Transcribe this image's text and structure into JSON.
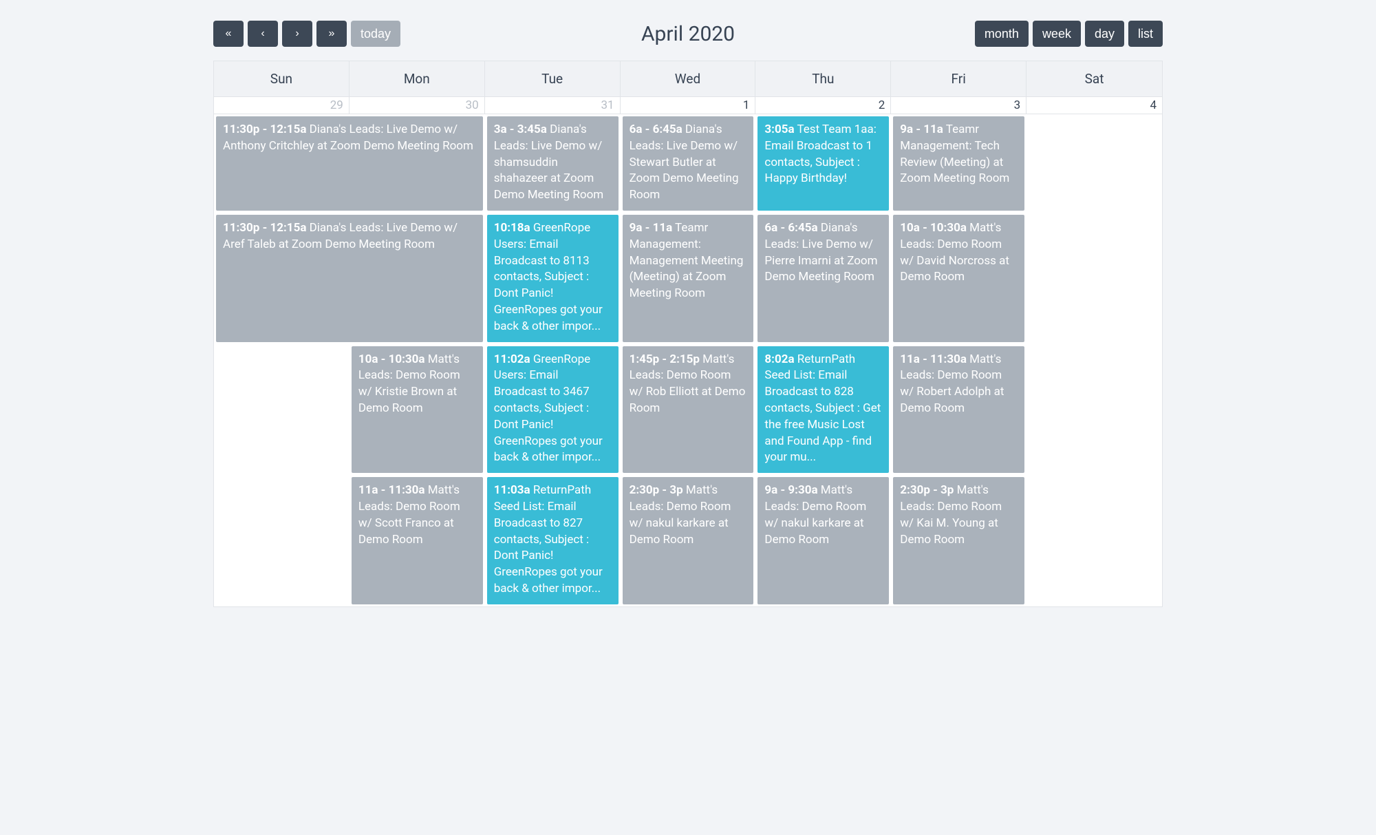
{
  "toolbar": {
    "today_label": "today"
  },
  "title": "April 2020",
  "views": {
    "month": "month",
    "week": "week",
    "day": "day",
    "list": "list"
  },
  "day_headers": [
    "Sun",
    "Mon",
    "Tue",
    "Wed",
    "Thu",
    "Fri",
    "Sat"
  ],
  "dates": [
    "29",
    "30",
    "31",
    "1",
    "2",
    "3",
    "4"
  ],
  "events": {
    "r0": {
      "e0": {
        "time": "11:30p - 12:15a",
        "text": " Diana's Leads: Live Demo w/ Anthony Critchley at Zoom Demo Meeting Room"
      },
      "e2": {
        "time": "3a - 3:45a",
        "text": " Diana's Leads: Live Demo w/ shamsuddin shahazeer at Zoom Demo Meeting Room"
      },
      "e3": {
        "time": "6a - 6:45a",
        "text": " Diana's Leads: Live Demo w/ Stewart Butler at Zoom Demo Meeting Room"
      },
      "e4": {
        "time": "3:05a",
        "text": " Test Team 1aa: Email Broadcast to 1 contacts, Subject : Happy Birthday!"
      },
      "e5": {
        "time": "9a - 11a",
        "text": " Teamr Management: Tech Review (Meeting) at Zoom Meeting Room"
      }
    },
    "r1": {
      "e0": {
        "time": "11:30p - 12:15a",
        "text": " Diana's Leads: Live Demo w/ Aref Taleb at Zoom Demo Meeting Room"
      },
      "e2": {
        "time": "10:18a",
        "text": " GreenRope Users: Email Broadcast to 8113 contacts, Subject : Dont Panic! GreenRopes got your back & other impor..."
      },
      "e3": {
        "time": "9a - 11a",
        "text": " Teamr Management: Management Meeting (Meeting) at Zoom Meeting Room"
      },
      "e4": {
        "time": "6a - 6:45a",
        "text": " Diana's Leads: Live Demo w/ Pierre Imarni at Zoom Demo Meeting Room"
      },
      "e5": {
        "time": "10a - 10:30a",
        "text": " Matt's Leads: Demo Room w/ David Norcross at Demo Room"
      }
    },
    "r2": {
      "e1": {
        "time": "10a - 10:30a",
        "text": " Matt's Leads: Demo Room w/ Kristie Brown at Demo Room"
      },
      "e2": {
        "time": "11:02a",
        "text": " GreenRope Users: Email Broadcast to 3467 contacts, Subject : Dont Panic! GreenRopes got your back & other impor..."
      },
      "e3": {
        "time": "1:45p - 2:15p",
        "text": " Matt's Leads: Demo Room w/ Rob Elliott at Demo Room"
      },
      "e4": {
        "time": "8:02a",
        "text": " ReturnPath Seed List: Email Broadcast to 828 contacts, Subject : Get the free Music Lost and Found App - find your mu..."
      },
      "e5": {
        "time": "11a - 11:30a",
        "text": " Matt's Leads: Demo Room w/ Robert Adolph at Demo Room"
      }
    },
    "r3": {
      "e1": {
        "time": "11a - 11:30a",
        "text": " Matt's Leads: Demo Room w/ Scott Franco at Demo Room"
      },
      "e2": {
        "time": "11:03a",
        "text": " ReturnPath Seed List: Email Broadcast to 827 contacts, Subject : Dont Panic! GreenRopes got your back & other impor..."
      },
      "e3": {
        "time": "2:30p - 3p",
        "text": " Matt's Leads: Demo Room w/ nakul karkare at Demo Room"
      },
      "e4": {
        "time": "9a - 9:30a",
        "text": " Matt's Leads: Demo Room w/ nakul karkare at Demo Room"
      },
      "e5": {
        "time": "2:30p - 3p",
        "text": " Matt's Leads: Demo Room w/ Kai M. Young at Demo Room"
      }
    }
  }
}
